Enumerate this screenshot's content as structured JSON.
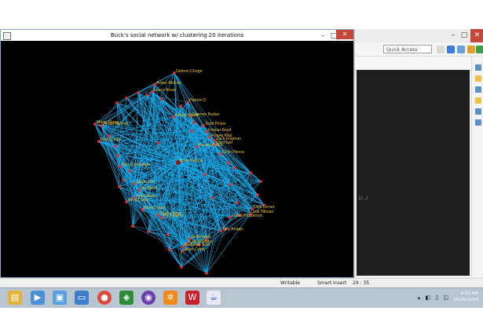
{
  "network_window": {
    "title": "Buck's social network w/ clustering 20 iterations",
    "controls": {
      "minimize": "–",
      "maximize": "□",
      "close": "✕"
    },
    "node_labels": [
      "Gideon Choge",
      "Arthur Bleiner",
      "Laura Rossi",
      "Patrick O",
      "Corinne Bodan",
      "Kristie Olson",
      "Maria Stone",
      "Jamal Nichols",
      "Todd Picker",
      "Kristen Boyd",
      "Renee Pike",
      "Zack Engman",
      "Kelsey Parks",
      "Raj Patel",
      "Colin Pierce",
      "Holly Dean",
      "Buck Dennis",
      "Ben Cummings",
      "Sarah Lee",
      "Ian Reed",
      "Jeff Gibson",
      "Nora Quinn",
      "Rosa Lopez",
      "Ryan Fisher",
      "Dick Lerner",
      "Jodi Tillman",
      "Lucas Fitzpatrick",
      "Tory Knapp",
      "Jill Bennett",
      "Kate Wallace",
      "Kathleen Best",
      "Allen Carey",
      "Paul Harris"
    ],
    "colors": {
      "edge": "#1aa8e8",
      "node": "#e03030",
      "label": "#f2c531",
      "background": "#000000"
    }
  },
  "eclipse_window": {
    "quick_access_placeholder": "Quick Access",
    "console_hint": "1(..)",
    "controls": {
      "minimize": "–",
      "maximize": "□",
      "close": "✕"
    }
  },
  "status_bar": {
    "writable": "Writable",
    "insert_mode": "Smart Insert",
    "position": "29 : 35"
  },
  "taskbar": {
    "apps": [
      "file-explorer-icon",
      "media-icon",
      "photos-icon",
      "folder-icon",
      "chrome-icon",
      "xbox-icon",
      "game-icon",
      "settings-icon",
      "wps-icon",
      "java-icon"
    ],
    "time": "9:52 AM",
    "date": "10/26/2014"
  }
}
